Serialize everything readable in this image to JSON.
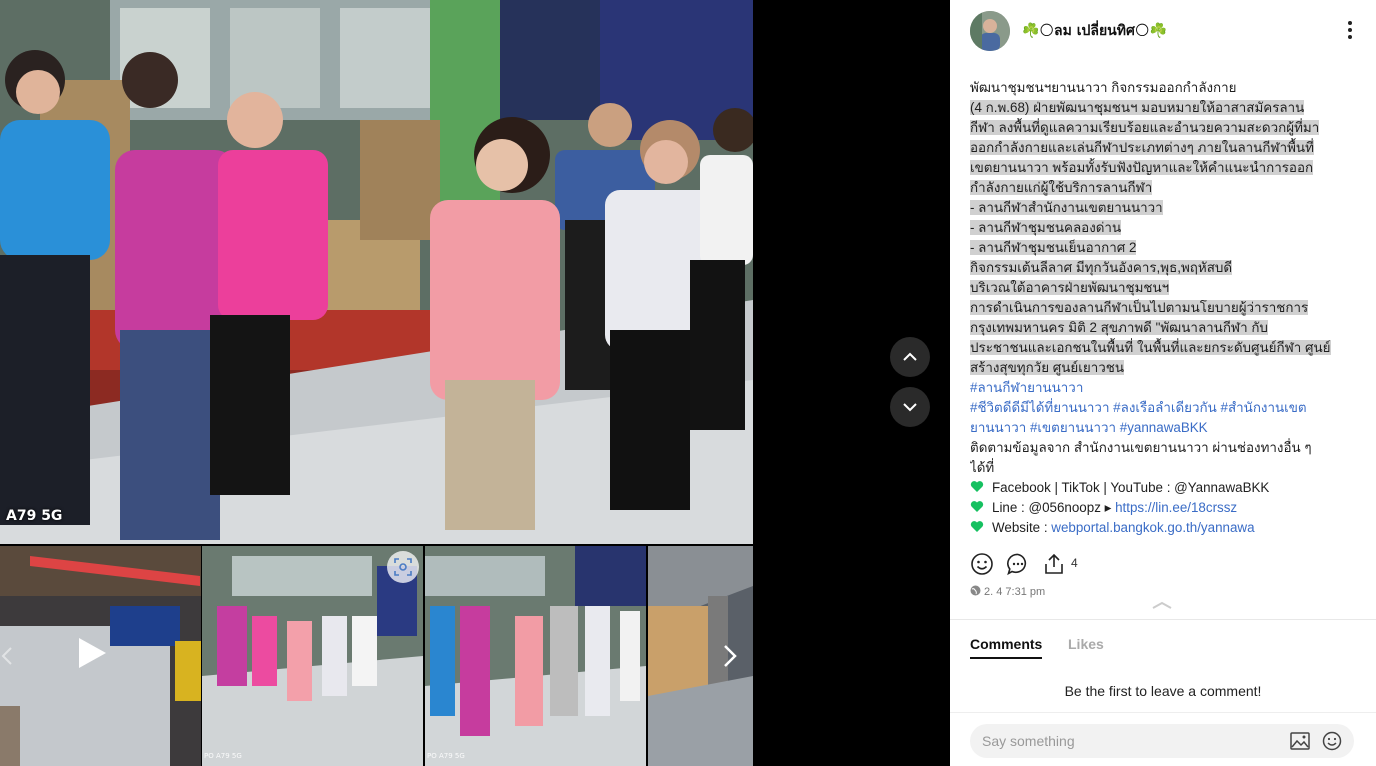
{
  "media": {
    "watermark": "A79 5G",
    "thumb_watermark": "PO A79 5G"
  },
  "post": {
    "author": "☘️🌕ลม เปลี่ยนทิศ🌕☘️",
    "caption": {
      "lines": [
        "พัฒนาชุมชนฯยานนาวา กิจกรรมออกกำลังกาย",
        " (4 ก.พ.68)  ฝ่ายพัฒนาชุมชนฯ มอบหมายให้อาสาสมัครลาน",
        "กีฬา ลงพื้นที่ดูแลความเรียบร้อยและอำนวยความสะดวกผู้ที่มา",
        "ออกกำลังกายและเล่นกีฬาประเภทต่างๆ ภายในลานกีฬาพื้นที่",
        "เขตยานนาวา พร้อมทั้งรับฟังปัญหาและให้คำแนะนำการออก",
        "กำลังกายแก่ผู้ใช้บริการลานกีฬา",
        "- ลานกีฬาสำนักงานเขตยานนาวา",
        "- ลานกีฬาชุมชนคลองด่าน",
        "- ลานกีฬาชุมชนเย็นอากาศ 2",
        "กิจกรรมเต้นลีลาศ มีทุกวันอังคาร,พุธ,พฤหัสบดี",
        "บริเวณใต้อาคารฝ่ายพัฒนาชุมชนฯ",
        "   การดำเนินการของลานกีฬาเป็นไปตามนโยบายผู้ว่าราชการ",
        "กรุงเทพมหานคร  มิติ 2 สุขภาพดี  \"พัฒนาลานกีฬา กับ",
        "ประชาชนและเอกชนในพื้นที่ ในพื้นที่และยกระดับศูนย์กีฬา ศูนย์",
        "สร้างสุขทุกวัย ศูนย์เยาวชน"
      ],
      "hashtag_line_1": "#ลานกีฬายานนาวา",
      "hashtag_line_2": "#ชีวิตดีดีมีได้ที่ยานนาวา #ลงเรือลำเดียวกัน #สำนักงานเขต",
      "hashtag_line_3": "ยานนาวา #เขตยานนาวา #yannawaBKK",
      "follow_line_1": "ติดตามข้อมูลจาก สำนักงานเขตยานนาวา ผ่านช่องทางอื่น ๆ",
      "follow_line_2": "ได้ที่",
      "social_line": "Facebook | TikTok | YouTube : @YannawaBKK",
      "line_label": "Line : @056noopz ▸ ",
      "line_link": "https://lin.ee/18crssz",
      "website_label": "Website : ",
      "website_link": "webportal.bangkok.go.th/yannawa"
    },
    "share_count": "4",
    "timestamp": "2. 4 7:31 pm"
  },
  "tabs": {
    "comments": "Comments",
    "likes": "Likes"
  },
  "comments": {
    "empty_message": "Be the first to leave a comment!",
    "placeholder": "Say something"
  },
  "icons": {
    "up": "chevron-up-icon",
    "down": "chevron-down-icon",
    "play": "play-icon",
    "more": "more-vertical-icon",
    "like": "smiley-icon",
    "comment": "comment-bubble-icon",
    "share": "share-icon",
    "globe": "globe-icon",
    "heart": "green-heart-icon",
    "image": "image-icon",
    "emoji": "emoji-icon"
  },
  "colors": {
    "panel_bg": "#ffffff",
    "hashtag": "#3a6cc6",
    "highlight": "#d0d0d0",
    "heart": "#16c060"
  }
}
